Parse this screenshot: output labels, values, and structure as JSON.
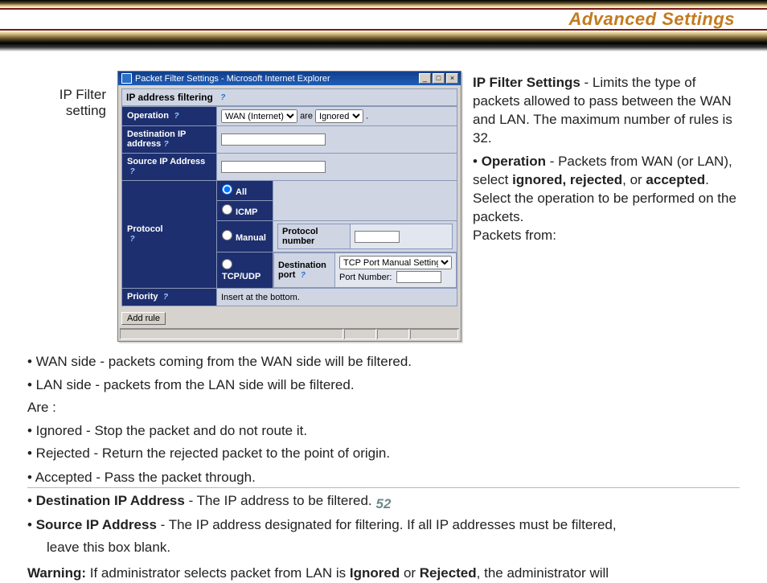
{
  "header": {
    "title": "Advanced Settings"
  },
  "sidelabel": {
    "line1": "IP Filter",
    "line2": "setting"
  },
  "window": {
    "title": "Packet Filter Settings - Microsoft Internet Explorer",
    "section_heading": "IP address filtering",
    "rows": {
      "operation": {
        "label": "Operation",
        "select1": "WAN (Internet)",
        "mid": "are",
        "select2": "Ignored",
        "dot": "."
      },
      "dest_ip": {
        "label": "Destination IP address"
      },
      "src_ip": {
        "label": "Source IP Address"
      },
      "protocol": {
        "label": "Protocol",
        "opts": {
          "all": "All",
          "icmp": "ICMP",
          "manual": "Manual",
          "tcpudp": "TCP/UDP"
        },
        "proto_num_label": "Protocol number",
        "dest_port_label": "Destination port",
        "dest_port_select": "TCP Port Manual Setting",
        "port_num_label": "Port Number:"
      },
      "priority": {
        "label": "Priority",
        "value": "Insert at the bottom."
      }
    },
    "add_button": "Add rule"
  },
  "right": {
    "p1_bold": "IP Filter Settings",
    "p1_rest": " - Limits the type of packets allowed to pass between the WAN and LAN. The maximum number of rules is 32.",
    "p2_bullet": "• ",
    "p2_b1": "Operation",
    "p2_t1": " - Packets from WAN (or LAN), select ",
    "p2_b2": "ignored, rejected",
    "p2_t2": ", or ",
    "p2_b3": "accepted",
    "p2_t3": ".  Select the operation to be performed on the packets.",
    "p2_last": "Packets from:"
  },
  "lower": {
    "l1": "• WAN side - packets coming from the WAN side will be filtered.",
    "l2": "• LAN side - packets from the LAN side will be filtered.",
    "l3": "Are :",
    "l4": "• Ignored - Stop the packet and do not route it.",
    "l5": "• Rejected - Return the rejected packet to the point of origin.",
    "l6": "•  Accepted - Pass the packet through.",
    "l7_pre": "• ",
    "l7_b": "Destination IP Address",
    "l7_post": " - The IP address to be filtered.",
    "l8_pre": "• ",
    "l8_b": "Source IP Address",
    "l8_post": " - The IP address designated for filtering. If all IP addresses must be filtered,",
    "l8_cont": "leave this box blank.",
    "l9_b": "Warning:",
    "l9_t1": " If administrator selects packet from LAN is ",
    "l9_b2": "Ignored",
    "l9_t2": " or ",
    "l9_b3": "Rejected",
    "l9_t3": ", the administrator will"
  },
  "page_number": "52"
}
